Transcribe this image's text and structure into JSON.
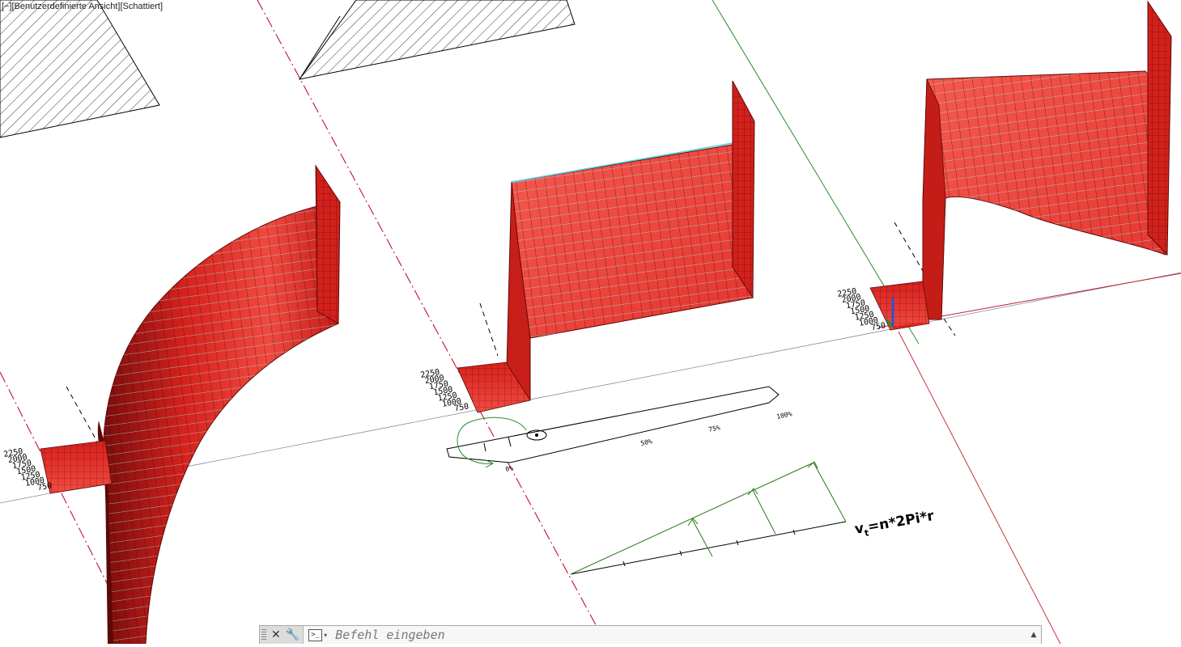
{
  "viewport": {
    "label": "[−][Benutzerdefinierte Ansicht][Schattiert]",
    "view_name": "Benutzerdefinierte Ansicht",
    "visual_style": "Schattiert",
    "face_color": "#e8241f",
    "grid_color": "#7fd8e8",
    "axis_x_color": "#c0202a",
    "axis_y_color": "#2b8a2b",
    "centerline_color": "#c8102e"
  },
  "scale_labels": [
    "2250",
    "2000",
    "1750",
    "1500",
    "1250",
    "1000",
    "750"
  ],
  "slider": {
    "labels": [
      "0%",
      "50%",
      "75%",
      "100%"
    ]
  },
  "formula": {
    "text": "v",
    "subscript": "t",
    "rest": "=n*2Pi*r"
  },
  "command_line": {
    "placeholder": "Befehl eingeben",
    "close_icon": "close-icon",
    "customize_icon": "wrench-icon",
    "prompt_icon": "command-prompt-icon",
    "history_icon": "chevron-up-icon"
  }
}
